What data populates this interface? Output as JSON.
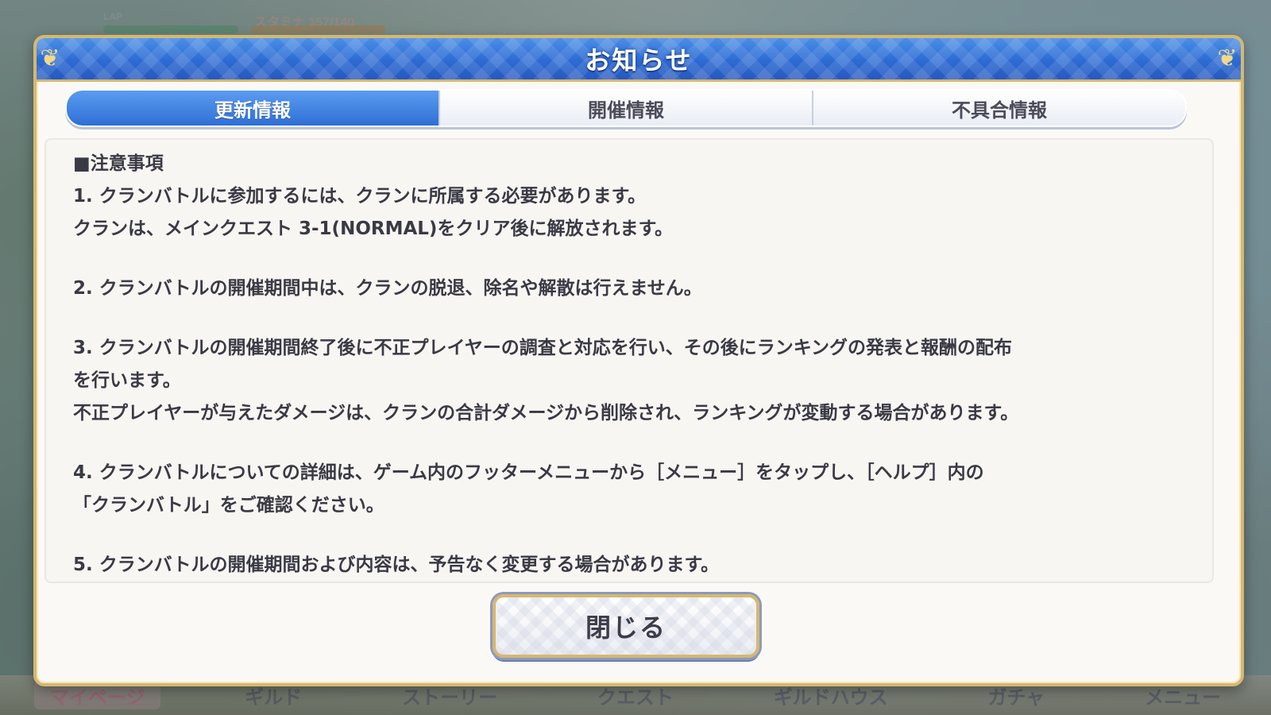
{
  "background": {
    "status": {
      "level_label": "LAP",
      "stamina_text": "スタミナ 157/140"
    },
    "bottom_nav": [
      {
        "label": "マイページ",
        "active": true
      },
      {
        "label": "ギルド",
        "active": false
      },
      {
        "label": "ストーリー",
        "active": false
      },
      {
        "label": "クエスト",
        "active": false
      },
      {
        "label": "ギルドハウス",
        "active": false
      },
      {
        "label": "ガチャ",
        "active": false
      },
      {
        "label": "メニュー",
        "active": false
      }
    ]
  },
  "dialog": {
    "title": "お知らせ",
    "tabs": [
      {
        "label": "更新情報",
        "active": true
      },
      {
        "label": "開催情報",
        "active": false
      },
      {
        "label": "不具合情報",
        "active": false
      }
    ],
    "content": {
      "heading": "■注意事項",
      "lines": [
        "1. クランバトルに参加するには、クランに所属する必要があります。",
        "クランは、メインクエスト 3-1(NORMAL)をクリア後に解放されます。",
        "",
        "2. クランバトルの開催期間中は、クランの脱退、除名や解散は行えません。",
        "",
        "3. クランバトルの開催期間終了後に不正プレイヤーの調査と対応を行い、その後にランキングの発表と報酬の配布",
        "を行います。",
        "不正プレイヤーが与えたダメージは、クランの合計ダメージから削除され、ランキングが変動する場合があります。",
        "",
        "4. クランバトルについての詳細は、ゲーム内のフッターメニューから［メニュー］をタップし、［ヘルプ］内の",
        "「クランバトル」をご確認ください。",
        "",
        "5. クランバトルの開催期間および内容は、予告なく変更する場合があります。"
      ]
    },
    "close_label": "閉じる"
  },
  "colors": {
    "header_blue": "#2d6bd3",
    "gold_border": "#d5b870",
    "panel_bg": "#f8f6f3",
    "text": "#3a3a44"
  }
}
